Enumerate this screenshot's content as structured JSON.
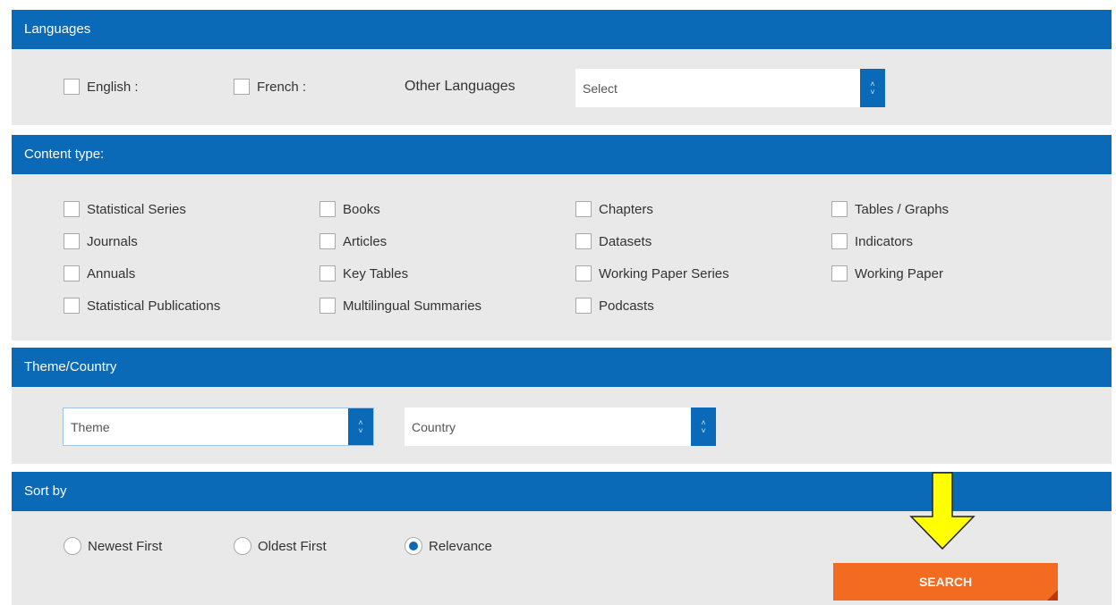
{
  "languages": {
    "header": "Languages",
    "english": "English :",
    "french": "French :",
    "other_label": "Other Languages",
    "select_placeholder": "Select"
  },
  "content_type": {
    "header": "Content type:",
    "items": [
      "Statistical Series",
      "Books",
      "Chapters",
      "Tables / Graphs",
      "Journals",
      "Articles",
      "Datasets",
      "Indicators",
      "Annuals",
      "Key Tables",
      "Working Paper Series",
      "Working Paper",
      "Statistical Publications",
      "Multilingual Summaries",
      "Podcasts"
    ]
  },
  "theme_country": {
    "header": "Theme/Country",
    "theme_placeholder": "Theme",
    "country_placeholder": "Country"
  },
  "sort_by": {
    "header": "Sort by",
    "options": [
      "Newest First",
      "Oldest First",
      "Relevance"
    ],
    "selected": "Relevance"
  },
  "search_button": "SEARCH",
  "colors": {
    "header_blue": "#0a6ab8",
    "panel_gray": "#e9e9e9",
    "search_orange": "#f26b21",
    "arrow_yellow": "#ffff00"
  }
}
